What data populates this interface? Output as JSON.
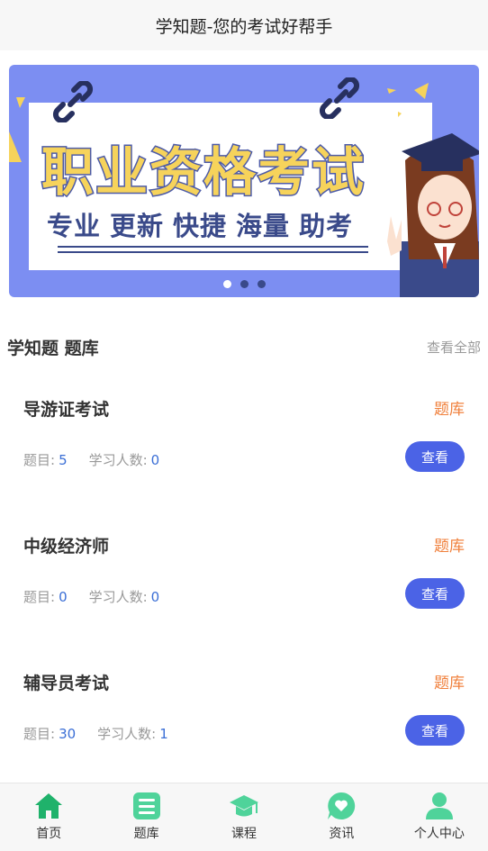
{
  "header": {
    "title": "学知题-您的考试好帮手"
  },
  "banner": {
    "title": "职业资格考试",
    "tagline": [
      "专业",
      "更新",
      "快捷",
      "海量",
      "助考"
    ],
    "slide_count": 3,
    "active_slide": 1
  },
  "section": {
    "title": "学知题 题库",
    "more_label": "查看全部"
  },
  "cards": [
    {
      "name": "导游证考试",
      "tag": "题库",
      "questions_label": "题目:",
      "questions": "5",
      "learners_label": "学习人数:",
      "learners": "0",
      "button": "查看"
    },
    {
      "name": "中级经济师",
      "tag": "题库",
      "questions_label": "题目:",
      "questions": "0",
      "learners_label": "学习人数:",
      "learners": "0",
      "button": "查看"
    },
    {
      "name": "辅导员考试",
      "tag": "题库",
      "questions_label": "题目:",
      "questions": "30",
      "learners_label": "学习人数:",
      "learners": "1",
      "button": "查看"
    }
  ],
  "tabbar": {
    "items": [
      {
        "label": "首页",
        "icon": "home-icon",
        "active": true
      },
      {
        "label": "题库",
        "icon": "list-icon"
      },
      {
        "label": "课程",
        "icon": "graduation-cap-icon"
      },
      {
        "label": "资讯",
        "icon": "chat-heart-icon"
      },
      {
        "label": "个人中心",
        "icon": "person-icon"
      }
    ],
    "icon_color": "#4fd39a",
    "active_color": "#1fb26b"
  },
  "colors": {
    "accent": "#4b63e6",
    "tag": "#f0803c",
    "number": "#3b6fd6",
    "banner_bg": "#7c8ef2"
  }
}
